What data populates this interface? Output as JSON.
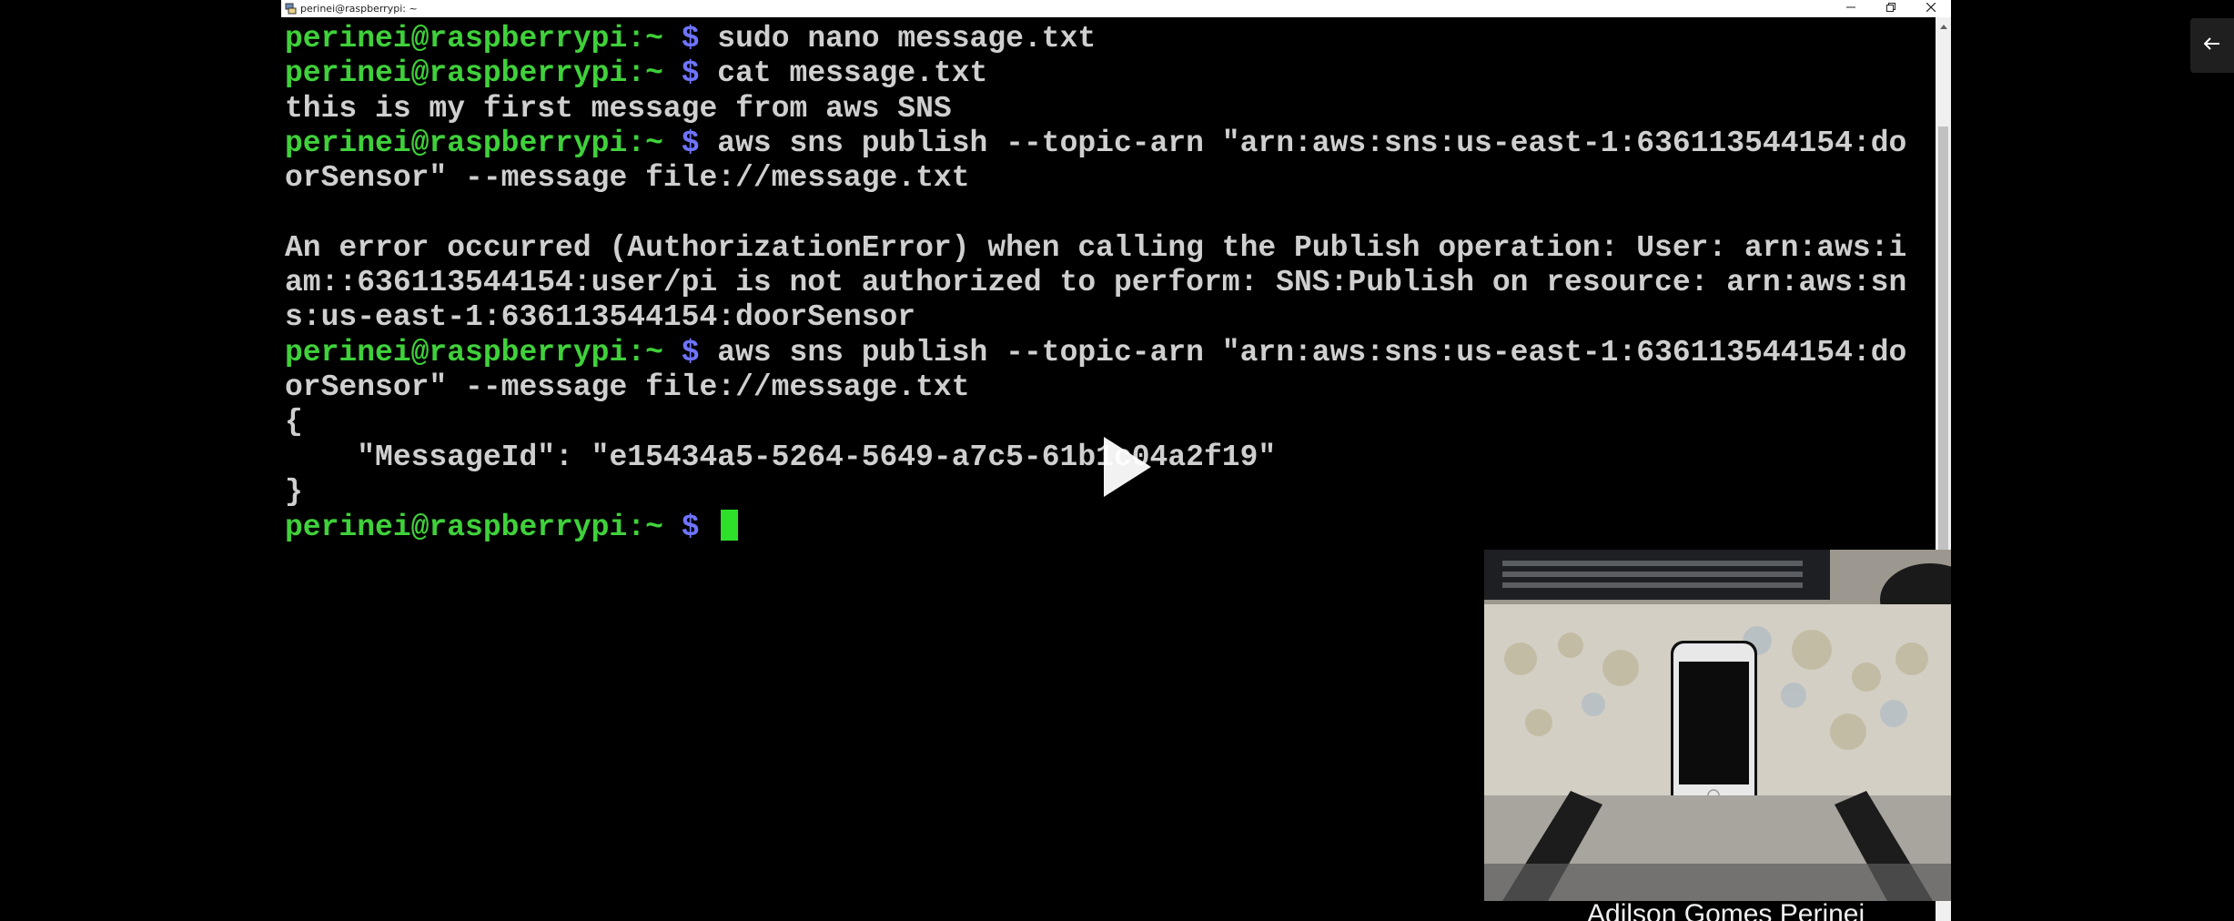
{
  "window": {
    "title": "perinei@raspberrypi: ~",
    "controls": [
      "minimize-icon",
      "restore-icon",
      "close-icon"
    ]
  },
  "terminal": {
    "lines": [
      {
        "kind": "cmd",
        "prompt": "perinei@raspberrypi",
        "path": ":~ ",
        "dollar": "$",
        "text": " sudo nano message.txt"
      },
      {
        "kind": "cmd",
        "prompt": "perinei@raspberrypi",
        "path": ":~ ",
        "dollar": "$",
        "text": " cat message.txt"
      },
      {
        "kind": "out",
        "text": "this is my first message from aws SNS"
      },
      {
        "kind": "cmd",
        "prompt": "perinei@raspberrypi",
        "path": ":~ ",
        "dollar": "$",
        "text": " aws sns publish --topic-arn \"arn:aws:sns:us-east-1:636113544154:do"
      },
      {
        "kind": "out",
        "text": "orSensor\" --message file://message.txt"
      },
      {
        "kind": "out",
        "text": ""
      },
      {
        "kind": "out",
        "text": "An error occurred (AuthorizationError) when calling the Publish operation: User: arn:aws:i"
      },
      {
        "kind": "out",
        "text": "am::636113544154:user/pi is not authorized to perform: SNS:Publish on resource: arn:aws:sn"
      },
      {
        "kind": "out",
        "text": "s:us-east-1:636113544154:doorSensor"
      },
      {
        "kind": "cmd",
        "prompt": "perinei@raspberrypi",
        "path": ":~ ",
        "dollar": "$",
        "text": " aws sns publish --topic-arn \"arn:aws:sns:us-east-1:636113544154:do"
      },
      {
        "kind": "out",
        "text": "orSensor\" --message file://message.txt"
      },
      {
        "kind": "out",
        "text": "{"
      },
      {
        "kind": "out",
        "text": "    \"MessageId\": \"e15434a5-5264-5649-a7c5-61b1c04a2f19\""
      },
      {
        "kind": "out",
        "text": "}"
      },
      {
        "kind": "cmd",
        "prompt": "perinei@raspberrypi",
        "path": ":~ ",
        "dollar": "$",
        "text": " ",
        "cursor": true
      }
    ]
  },
  "video": {
    "play_icon": "play-icon",
    "caption": "Adilson Gomes Perinei"
  },
  "sidebar": {
    "collapse_icon": "arrow-left-icon"
  },
  "colors": {
    "prompt": "#3fd13a",
    "dollar": "#6f74ff",
    "text": "#cfcfcf",
    "cursor": "#2ee02a",
    "background": "#000000"
  }
}
